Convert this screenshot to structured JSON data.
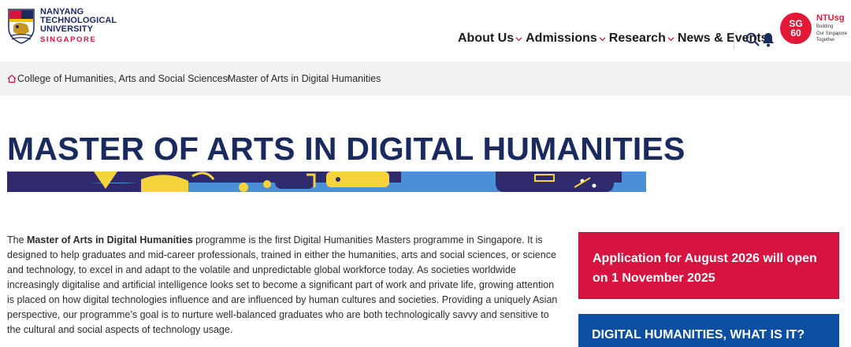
{
  "logo": {
    "line1": "NANYANG",
    "line2": "TECHNOLOGICAL",
    "line3": "UNIVERSITY",
    "line4": "SINGAPORE"
  },
  "nav": {
    "items": [
      {
        "label": "About Us",
        "has_dropdown": true
      },
      {
        "label": "Admissions",
        "has_dropdown": true
      },
      {
        "label": "Research",
        "has_dropdown": true
      },
      {
        "label": "News & Events",
        "has_dropdown": false
      }
    ]
  },
  "sg60": {
    "badge_top": "SG",
    "badge_bottom": "60",
    "title": "NTUsg",
    "sub1": "Building",
    "sub2": "Our Singapore",
    "sub3": "Together"
  },
  "breadcrumb": {
    "items": [
      "College of Humanities, Arts and Social Sciences",
      "Master of Arts in Digital Humanities"
    ]
  },
  "page": {
    "title": "MASTER OF ARTS IN DIGITAL HUMANITIES",
    "intro_pre": "The ",
    "intro_bold": "Master of Arts in Digital Humanities",
    "intro_post": " programme is the first Digital Humanities Masters programme in Singapore. It is designed to help graduates and mid-career professionals, trained in either the humanities, arts and social sciences, or science and technology, to excel in and adapt to the volatile and unpredictable global workforce today. As societies worldwide increasingly digitalise and artificial intelligence looks set to become a significant part of work and private life, growing attention is placed on how digital technologies influence and are influenced by human cultures and societies. Providing a uniquely Asian perspective, our programme’s goal is to nurture well-balanced graduates who are both technologically savvy and sensitive to the cultural and social aspects of technology usage."
  },
  "sidebar": {
    "application_notice": "Application for August 2026 will open on 1 November 2025",
    "dh_card": "DIGITAL HUMANITIES, WHAT IS IT?"
  },
  "colors": {
    "brand_navy": "#1b2a5e",
    "brand_red": "#d71440",
    "card_blue": "#0b4ea2"
  }
}
